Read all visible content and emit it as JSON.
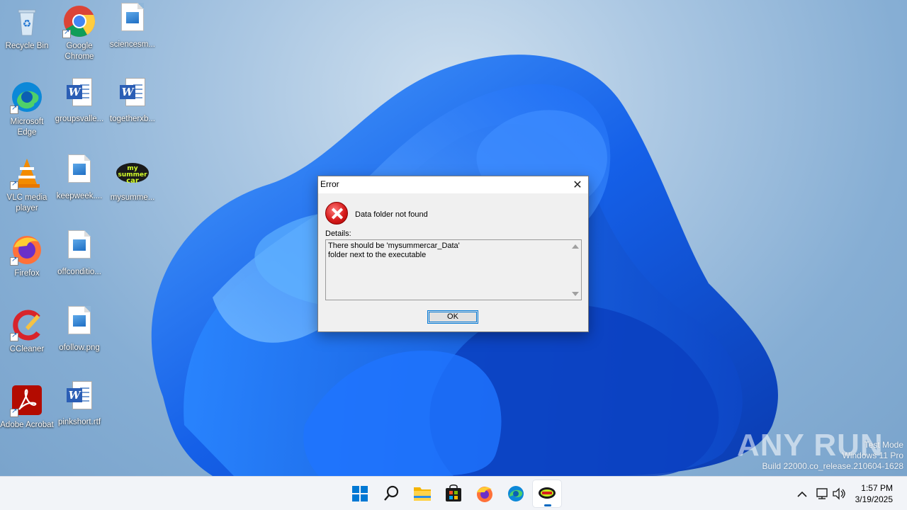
{
  "desktop": {
    "icons": [
      {
        "label": "Recycle Bin",
        "icon": "recycle-bin-icon"
      },
      {
        "label": "Google Chrome",
        "icon": "chrome-icon"
      },
      {
        "label": "sciencesm...",
        "icon": "image-file-icon"
      },
      {
        "label": "Microsoft Edge",
        "icon": "edge-icon"
      },
      {
        "label": "groupsvalle...",
        "icon": "word-document-icon"
      },
      {
        "label": "togetherxb...",
        "icon": "word-document-icon"
      },
      {
        "label": "VLC media player",
        "icon": "vlc-icon"
      },
      {
        "label": "keepweek....",
        "icon": "image-file-icon"
      },
      {
        "label": "mysumme...",
        "icon": "my-summer-car-icon"
      },
      {
        "label": "Firefox",
        "icon": "firefox-icon"
      },
      {
        "label": "offconditio...",
        "icon": "image-file-icon"
      },
      {
        "label": "CCleaner",
        "icon": "ccleaner-icon"
      },
      {
        "label": "ofollow.png",
        "icon": "image-file-icon"
      },
      {
        "label": "Adobe Acrobat",
        "icon": "acrobat-icon"
      },
      {
        "label": "pinkshort.rtf",
        "icon": "word-document-icon"
      }
    ]
  },
  "dialog": {
    "title": "Error",
    "close_label": "✕",
    "message": "Data folder not found",
    "details_label": "Details:",
    "details_text": "There should be 'mysummercar_Data'\nfolder next to the executable",
    "ok_label": "OK"
  },
  "watermark": {
    "line1": "Test Mode",
    "line2": "Windows 11 Pro",
    "line3": "Build 22000.co_release.210604-1628",
    "brand": "ANY RUN"
  },
  "taskbar": {
    "apps": [
      "start-icon",
      "search-icon",
      "file-explorer-icon",
      "store-icon",
      "firefox-icon",
      "edge-icon",
      "my-summer-car-icon"
    ],
    "time": "1:57 PM",
    "date": "3/19/2025"
  },
  "colors": {
    "accent": "#0078d7",
    "error_red": "#d61c1c",
    "taskbar_bg": "#f2f4f8"
  }
}
